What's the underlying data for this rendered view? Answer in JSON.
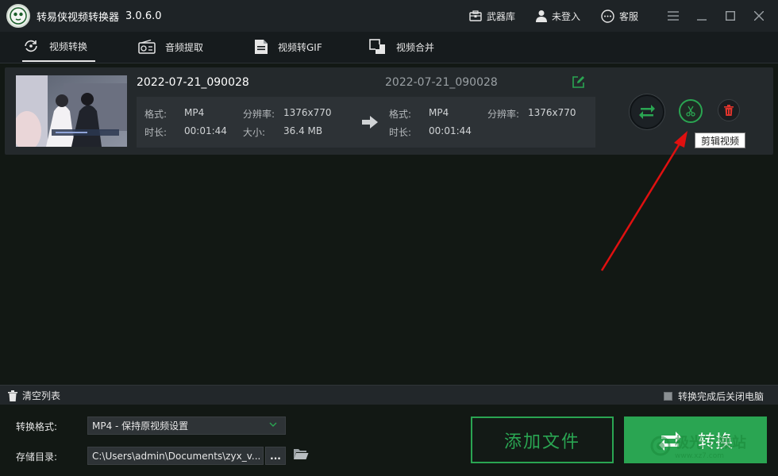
{
  "app": {
    "title": "转易侠视频转换器",
    "version": "3.0.6.0",
    "logo_icon": "panda-logo-icon"
  },
  "topbar": {
    "arsenal": "武器库",
    "login": "未登入",
    "service": "客服"
  },
  "tabs": [
    {
      "label": "视频转换",
      "icon": "video-convert-icon",
      "active": true
    },
    {
      "label": "音频提取",
      "icon": "radio-icon",
      "active": false
    },
    {
      "label": "视频转GIF",
      "icon": "gif-file-icon",
      "active": false
    },
    {
      "label": "视频合并",
      "icon": "merge-icon",
      "active": false
    }
  ],
  "file": {
    "source_name": "2022-07-21_090028",
    "output_name": "2022-07-21_090028",
    "source": {
      "format_label": "格式:",
      "format": "MP4",
      "resolution_label": "分辨率:",
      "resolution": "1376x770",
      "duration_label": "时长:",
      "duration": "00:01:44",
      "size_label": "大小:",
      "size": "36.4 MB"
    },
    "output": {
      "format_label": "格式:",
      "format": "MP4",
      "resolution_label": "分辨率:",
      "resolution": "1376x770",
      "duration_label": "时长:",
      "duration": "00:01:44"
    }
  },
  "tooltip": "剪辑视频",
  "bottom": {
    "clear_list": "清空列表",
    "auto_close": "转换完成后关闭电脑",
    "format_label": "转换格式:",
    "format_value": "MP4 - 保持原视频设置",
    "dir_label": "存储目录:",
    "dir_value": "C:\\Users\\admin\\Documents\\zyx_v...",
    "browse_label": "...",
    "add_files": "添加文件",
    "convert": "转换"
  },
  "watermark": {
    "text": "极光下载站",
    "url": "www.xz7.com"
  },
  "colors": {
    "accent": "#2aa552",
    "background": "#121814",
    "annotation_arrow": "#e01010"
  }
}
